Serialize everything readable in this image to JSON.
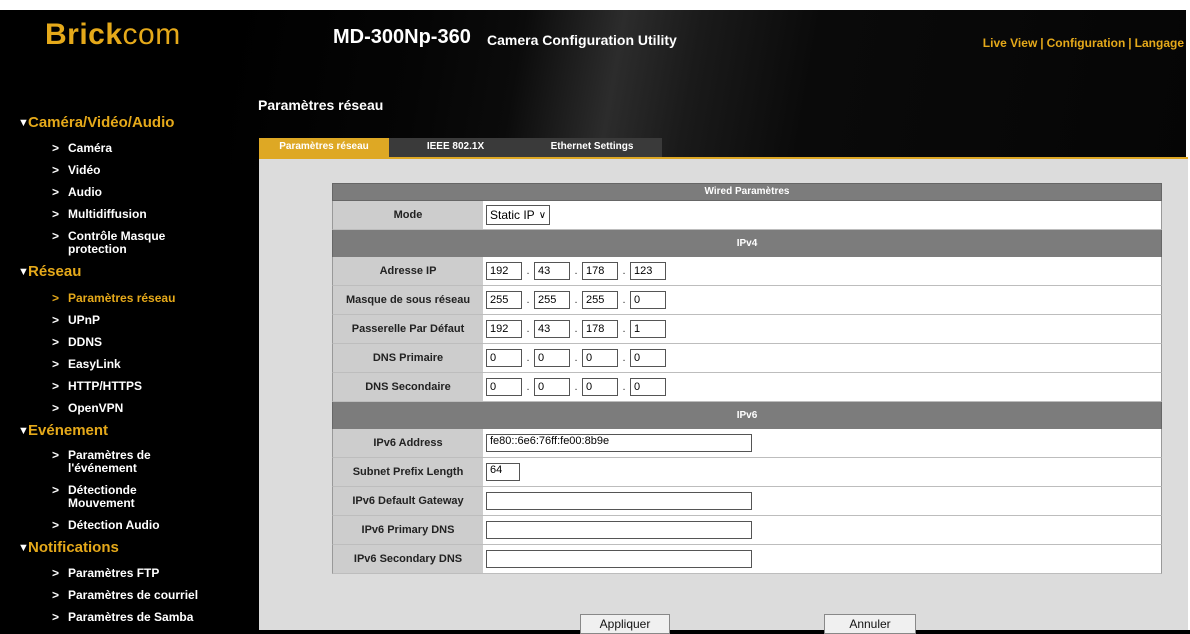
{
  "header": {
    "logo_bold": "Brick",
    "logo_light": "com",
    "model": "MD-300Np-360",
    "subtitle": "Camera Configuration Utility",
    "nav": [
      "Live View",
      "Configuration",
      "Langage"
    ]
  },
  "sidebar": {
    "sections": [
      {
        "title": "Caméra/Vidéo/Audio",
        "items": [
          "Caméra",
          "Vidéo",
          "Audio",
          "Multidiffusion",
          "Contrôle Masque protection"
        ]
      },
      {
        "title": "Réseau",
        "items": [
          "Paramètres réseau",
          "UPnP",
          "DDNS",
          "EasyLink",
          "HTTP/HTTPS",
          "OpenVPN"
        ]
      },
      {
        "title": "Evénement",
        "items": [
          "Paramètres de l'événement",
          "Détectionde Mouvement",
          "Détection Audio"
        ]
      },
      {
        "title": "Notifications",
        "items": [
          "Paramètres FTP",
          "Paramètres de courriel",
          "Paramètres de Samba"
        ]
      }
    ],
    "active_item": "Paramètres réseau"
  },
  "page_title": "Paramètres réseau",
  "tabs": [
    "Paramètres réseau",
    "IEEE 802.1X",
    "Ethernet Settings"
  ],
  "active_tab": "Paramètres réseau",
  "form": {
    "header": "Wired Paramètres",
    "mode_label": "Mode",
    "mode_value": "Static IP",
    "ipv4_header": "IPv4",
    "ipv4_rows": [
      {
        "label": "Adresse IP",
        "octets": [
          "192",
          "43",
          "178",
          "123"
        ]
      },
      {
        "label": "Masque de sous réseau",
        "octets": [
          "255",
          "255",
          "255",
          "0"
        ]
      },
      {
        "label": "Passerelle Par Défaut",
        "octets": [
          "192",
          "43",
          "178",
          "1"
        ]
      },
      {
        "label": "DNS Primaire",
        "octets": [
          "0",
          "0",
          "0",
          "0"
        ]
      },
      {
        "label": "DNS Secondaire",
        "octets": [
          "0",
          "0",
          "0",
          "0"
        ]
      }
    ],
    "ipv6_header": "IPv6",
    "ipv6_address_label": "IPv6 Address",
    "ipv6_address_value": "fe80::6e6:76ff:fe00:8b9e",
    "prefix_label": "Subnet Prefix Length",
    "prefix_value": "64",
    "gateway_label": "IPv6 Default Gateway",
    "gateway_value": "",
    "primary_dns_label": "IPv6 Primary DNS",
    "primary_dns_value": "",
    "secondary_dns_label": "IPv6 Secondary DNS",
    "secondary_dns_value": ""
  },
  "buttons": {
    "apply": "Appliquer",
    "cancel": "Annuler"
  },
  "colors": {
    "accent": "#e5a91a",
    "tab_active": "#dea824",
    "header_bar": "#7c7c7c"
  }
}
